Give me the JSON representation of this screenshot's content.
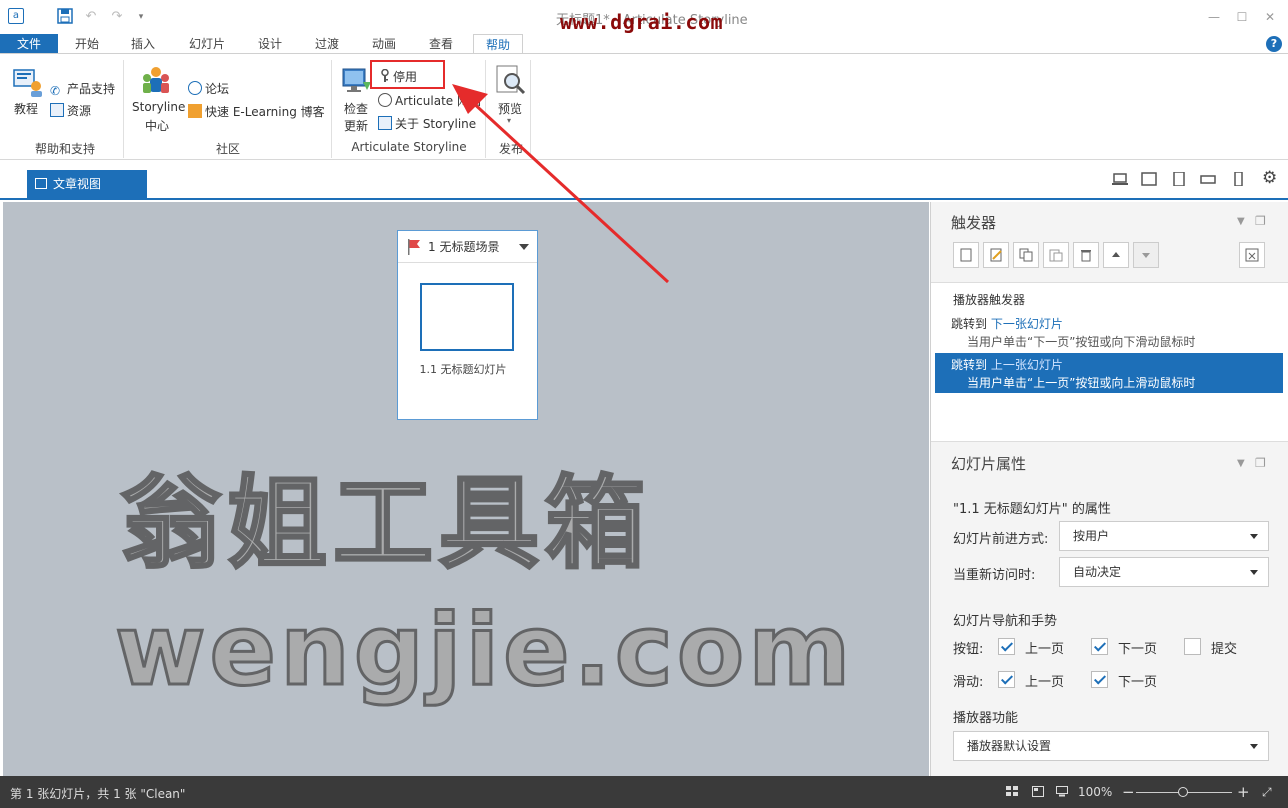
{
  "titlebar": {
    "app_icon": "storyline-app-icon",
    "title": "无标题1* - Articulate Storyline",
    "watermark_url": "www.dgrai.com"
  },
  "tabs": [
    {
      "label": "文件",
      "state": "file"
    },
    {
      "label": "开始",
      "state": "normal"
    },
    {
      "label": "插入",
      "state": "normal"
    },
    {
      "label": "幻灯片",
      "state": "normal"
    },
    {
      "label": "设计",
      "state": "normal"
    },
    {
      "label": "过渡",
      "state": "normal"
    },
    {
      "label": "动画",
      "state": "normal"
    },
    {
      "label": "查看",
      "state": "normal"
    },
    {
      "label": "帮助",
      "state": "active"
    }
  ],
  "ribbon": {
    "help_support": {
      "group_label": "帮助和支持",
      "tutorials": "教程",
      "product_support": "产品支持",
      "resources": "资源"
    },
    "community": {
      "group_label": "社区",
      "storyline_center_line1": "Storyline",
      "storyline_center_line2": "中心",
      "forums": "论坛",
      "blog": "快速 E-Learning 博客"
    },
    "articulate": {
      "group_label": "Articulate Storyline",
      "check_updates_line1": "检查",
      "check_updates_line2": "更新",
      "deactivate": "停用",
      "website": "Articulate 网站",
      "about": "关于 Storyline"
    },
    "publish": {
      "group_label": "发布",
      "preview": "预览"
    }
  },
  "view": {
    "story_view_tab": "文章视图"
  },
  "canvas": {
    "scene_title": "1 无标题场景",
    "slide_label": "1.1 无标题幻灯片",
    "watermark_line1": "翁姐工具箱",
    "watermark_line2": "wengjie.com"
  },
  "triggers": {
    "title": "触发器",
    "group_header": "播放器触发器",
    "items": [
      {
        "action": "跳转到",
        "target": "下一张幻灯片",
        "condition": "当用户单击“下一页”按钮或向下滑动鼠标时",
        "selected": false
      },
      {
        "action": "跳转到",
        "target": "上一张幻灯片",
        "condition": "当用户单击“上一页”按钮或向上滑动鼠标时",
        "selected": true
      }
    ]
  },
  "slide_props": {
    "title": "幻灯片属性",
    "subtitle": "\"1.1 无标题幻灯片\" 的属性",
    "advance_label": "幻灯片前进方式:",
    "advance_value": "按用户",
    "revisit_label": "当重新访问时:",
    "revisit_value": "自动决定",
    "nav_section": "幻灯片导航和手势",
    "buttons_label": "按钮:",
    "buttons": [
      {
        "label": "上一页",
        "checked": true
      },
      {
        "label": "下一页",
        "checked": true
      },
      {
        "label": "提交",
        "checked": false
      }
    ],
    "swipe_label": "滑动:",
    "swipe": [
      {
        "label": "上一页",
        "checked": true
      },
      {
        "label": "下一页",
        "checked": true
      }
    ],
    "player_section": "播放器功能",
    "player_value": "播放器默认设置"
  },
  "status": {
    "text": "第 1 张幻灯片，共 1 张    \"Clean\"",
    "zoom": "100%"
  },
  "colors": {
    "accent": "#1d6fb8",
    "highlight_box": "#e52b2b",
    "canvas_bg": "#b9c0c8",
    "status_bg": "#3a3a3a"
  }
}
